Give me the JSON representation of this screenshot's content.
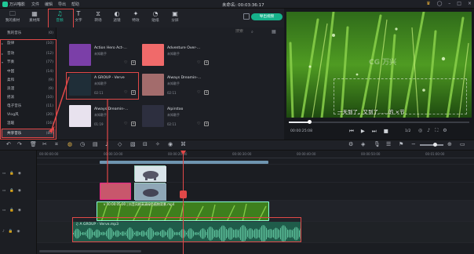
{
  "titlebar": {
    "app_name": "万兴喵影",
    "menus": [
      "文件",
      "编辑",
      "导出",
      "帮助"
    ],
    "project_title": "未命名: 00:03:36:17"
  },
  "toolbar": {
    "items": [
      {
        "icon": "folder-icon",
        "label": "我的素材"
      },
      {
        "icon": "media-icon",
        "label": "素材库"
      },
      {
        "icon": "music-note-icon",
        "label": "音频"
      },
      {
        "icon": "text-icon",
        "label": "文字"
      },
      {
        "icon": "transition-icon",
        "label": "转场"
      },
      {
        "icon": "effects-icon",
        "label": "滤镜"
      },
      {
        "icon": "elements-icon",
        "label": "特效"
      },
      {
        "icon": "sticker-icon",
        "label": "贴纸"
      },
      {
        "icon": "split-icon",
        "label": "分屏"
      }
    ],
    "export_label": "导出视频"
  },
  "categories": [
    {
      "label": "我的音乐",
      "count": "(0)",
      "arrow": ""
    },
    {
      "label": "旋律",
      "count": "(10)",
      "arrow": "▸"
    },
    {
      "label": "音效",
      "count": "(12)",
      "arrow": "▸"
    },
    {
      "label": "节奏",
      "count": "(77)",
      "arrow": "▾"
    },
    {
      "label": "中国",
      "count": "(14)",
      "arrow": ""
    },
    {
      "label": "柔和",
      "count": "(9)",
      "arrow": ""
    },
    {
      "label": "浪漫",
      "count": "(9)",
      "arrow": ""
    },
    {
      "label": "摇滚",
      "count": "(10)",
      "arrow": ""
    },
    {
      "label": "电子音乐",
      "count": "(11)",
      "arrow": ""
    },
    {
      "label": "Vlog风",
      "count": "(20)",
      "arrow": ""
    },
    {
      "label": "温暖",
      "count": "(16)",
      "arrow": ""
    },
    {
      "label": "共享音乐",
      "count": "(80)",
      "arrow": ""
    }
  ],
  "search": {
    "placeholder": "搜索"
  },
  "cards": [
    {
      "title": "Action Hero Act-…",
      "sub": "未知歌手",
      "duration": "",
      "thumb": "#7b3fa8"
    },
    {
      "title": "Adventure Over-…",
      "sub": "未知歌手",
      "duration": "",
      "thumb": "#f06a6a"
    },
    {
      "title": "A GROUP - Verve",
      "sub": "未知歌手",
      "duration": "02:11",
      "thumb": "#1f2e38"
    },
    {
      "title": "Always Dreamin-…",
      "sub": "未知歌手",
      "duration": "02:11",
      "thumb": "#a36c6c"
    },
    {
      "title": "Always Dreamin-…",
      "sub": "未知歌手",
      "duration": "01:19",
      "thumb": "#e8e2ee"
    },
    {
      "title": "Alpirstoo",
      "sub": "未知歌手",
      "duration": "02:11",
      "thumb": "#2d2f3f"
    }
  ],
  "preview": {
    "subtitle": "一天到了，又到了……的 ×节",
    "watermark": "CG 万兴",
    "timecode": "00:00:25:08",
    "page": "1/2",
    "progress": 0.11
  },
  "ruler": {
    "ticks": [
      "00:00:00:00",
      "00:00:10:00",
      "00:00:20:00",
      "00:00:30:00",
      "00:00:40:00",
      "00:00:50:00",
      "00:01:00:00"
    ]
  },
  "tracks": {
    "grass_label": "v 00:00:05:00 | 抖音风格高清绿色植物背景.mp4",
    "audio_label": "♫ A GROUP - Verve.mp3"
  }
}
